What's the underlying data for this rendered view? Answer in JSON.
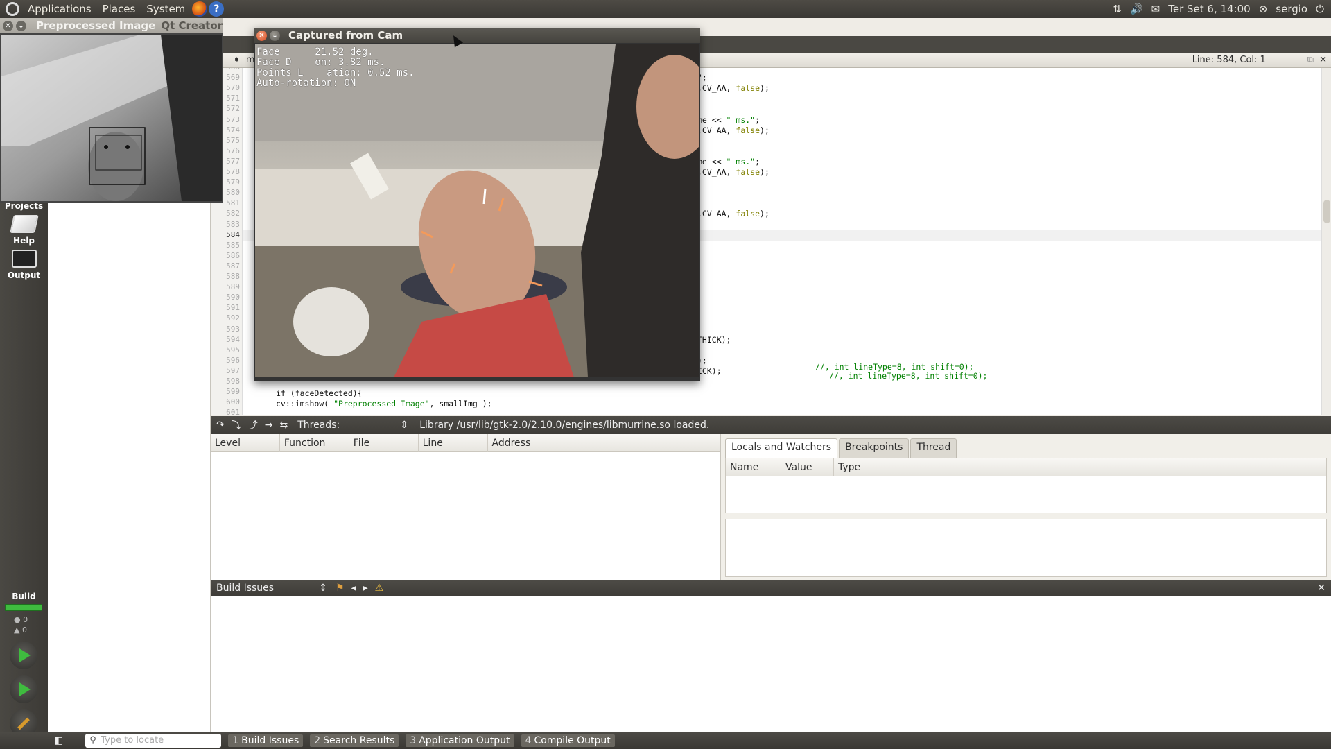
{
  "top_panel": {
    "menus": [
      "Applications",
      "Places",
      "System"
    ],
    "datetime": "Ter Set  6, 14:00",
    "user": "sergio"
  },
  "preprocessed_window": {
    "title": "Preprocessed Image",
    "behind_title": "Qt Creator"
  },
  "cam_window": {
    "title": "Captured from Cam",
    "overlay_lines": [
      "Face      21.52 deg.",
      "Face D    on: 3.82 ms.",
      "Points L    ation: 0.52 ms.",
      "Auto-rotation: ON"
    ]
  },
  "modes": {
    "projects": "Projects",
    "help": "Help",
    "output": "Output",
    "build": "Build",
    "error_count": "0",
    "warning_count": "0"
  },
  "editor": {
    "cursor_position": "Line: 584, Col: 1",
    "file_label": "m",
    "line_numbers": [
      "568",
      "569",
      "570",
      "571",
      "572",
      "573",
      "574",
      "575",
      "576",
      "577",
      "578",
      "579",
      "580",
      "581",
      "582",
      "583",
      "584",
      "585",
      "586",
      "587",
      "588",
      "589",
      "590",
      "591",
      "592",
      "593",
      "594",
      "595",
      "596",
      "597",
      "598",
      "599",
      "600",
      "601"
    ],
    "current_line": "584",
    "fragments": [
      {
        "text": "\";",
        "line": 1
      },
      {
        "text": ",CV_AA, false);",
        "line": 2
      },
      {
        "text": "me << \" ms.\";",
        "line": 5
      },
      {
        "text": ",CV_AA, false);",
        "line": 6
      },
      {
        "text": "me << \" ms.\";",
        "line": 9
      },
      {
        "text": ",CV_AA, false);",
        "line": 10
      },
      {
        "text": ",CV_AA, false);",
        "line": 14
      },
      {
        "text": "THICK);",
        "line": 26
      },
      {
        "text": ");",
        "line": 28
      },
      {
        "text": "ICK);",
        "line": 29
      }
    ],
    "comment1": "//, int lineType=8, int shift=0);",
    "comment2": "//, int lineType=8, int shift=0);",
    "line599": "if (faceDetected){",
    "line600_pre": "cv::imshow( ",
    "line600_str": "\"Preprocessed Image\"",
    "line600_post": ", smallImg );"
  },
  "debugger": {
    "threads_label": "Threads:",
    "message": "Library /usr/lib/gtk-2.0/2.10.0/engines/libmurrine.so loaded.",
    "stack_columns": [
      "Level",
      "Function",
      "File",
      "Line",
      "Address"
    ],
    "locals_tabs": [
      "Locals and Watchers",
      "Breakpoints",
      "Thread"
    ],
    "locals_columns": [
      "Name",
      "Value",
      "Type"
    ]
  },
  "build_issues": {
    "title": "Build Issues"
  },
  "status_bar": {
    "locator_placeholder": "Type to locate",
    "output_tabs": [
      {
        "num": "1",
        "label": "Build Issues"
      },
      {
        "num": "2",
        "label": "Search Results"
      },
      {
        "num": "3",
        "label": "Application Output"
      },
      {
        "num": "4",
        "label": "Compile Output"
      }
    ]
  }
}
